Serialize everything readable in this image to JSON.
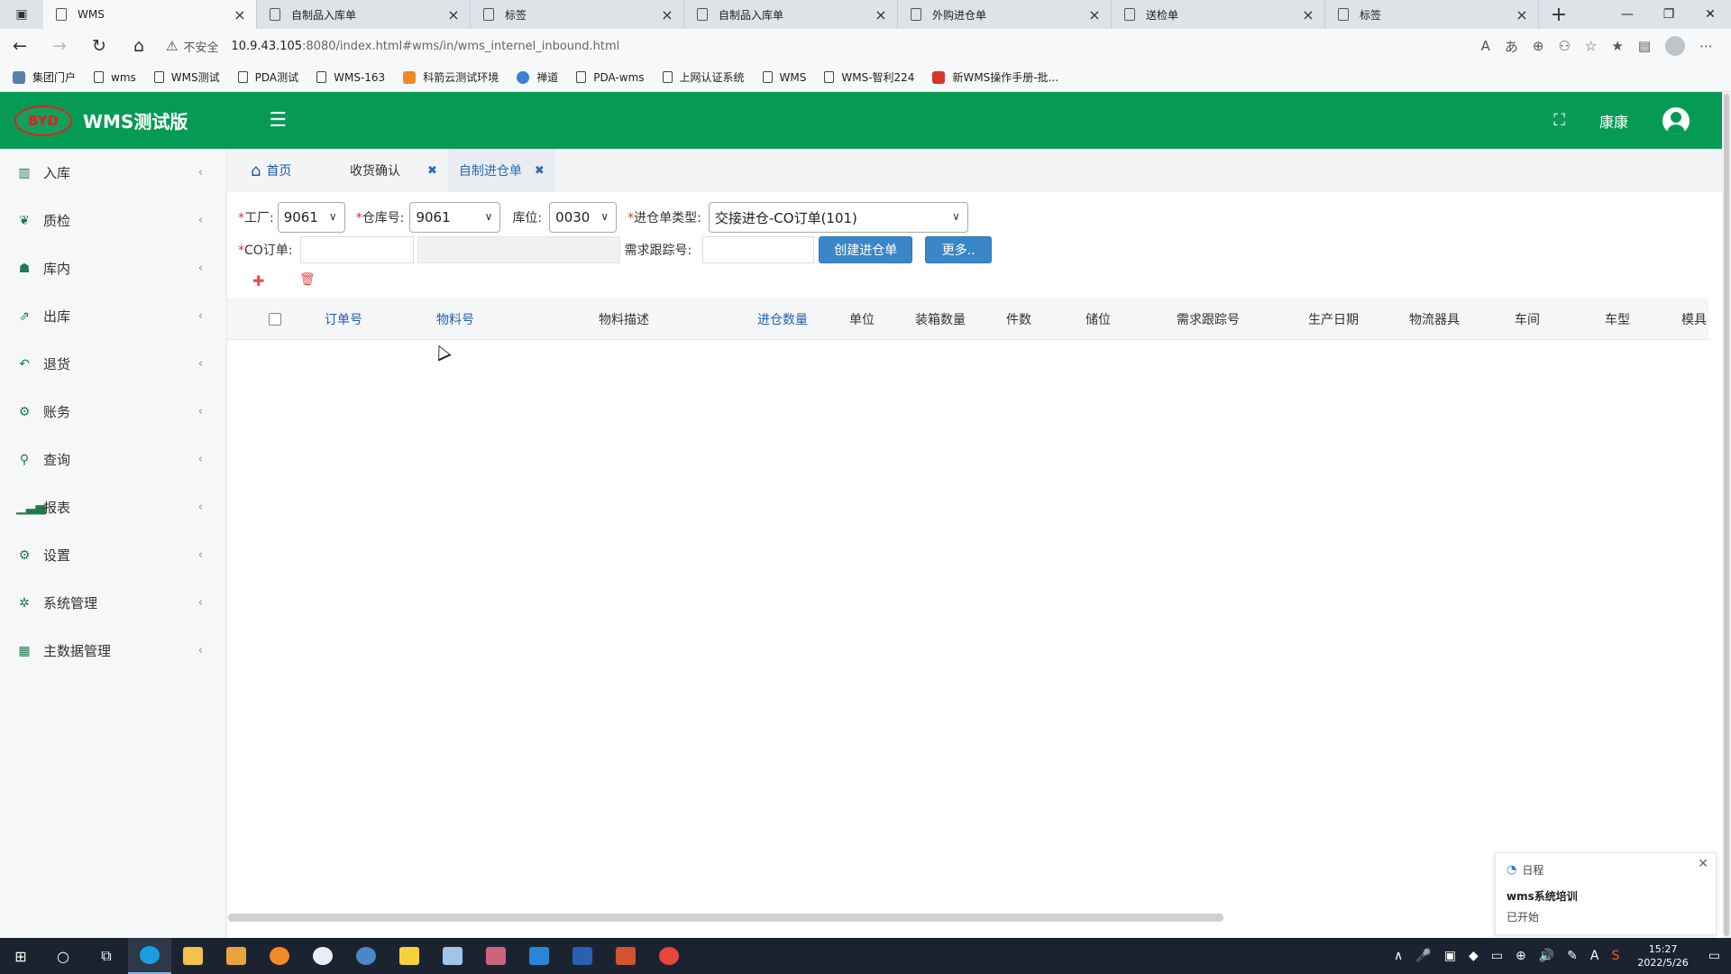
{
  "browser": {
    "tabs": [
      {
        "title": "WMS",
        "active": true
      },
      {
        "title": "自制品入库单",
        "active": false
      },
      {
        "title": "标签",
        "active": false
      },
      {
        "title": "自制品入库单",
        "active": false
      },
      {
        "title": "外购进仓单",
        "active": false
      },
      {
        "title": "送检单",
        "active": false
      },
      {
        "title": "标签",
        "active": false
      }
    ],
    "insecure_label": "不安全",
    "url_host": "10.9.43.105",
    "url_rest": ":8080/index.html#wms/in/wms_internel_inbound.html",
    "bookmarks": [
      "集团门户",
      "wms",
      "WMS测试",
      "PDA测试",
      "WMS-163",
      "科箭云测试环境",
      "禅道",
      "PDA-wms",
      "上网认证系统",
      "WMS",
      "WMS-智利224",
      "新WMS操作手册-批..."
    ]
  },
  "header": {
    "logo_text": "BYD",
    "title": "WMS测试版",
    "username": "康康",
    "brand_color": "#069b55"
  },
  "sidebar": {
    "items": [
      {
        "label": "入库",
        "icon": "barcode-icon"
      },
      {
        "label": "质检",
        "icon": "leaf-icon"
      },
      {
        "label": "库内",
        "icon": "cubes-icon"
      },
      {
        "label": "出库",
        "icon": "share-icon"
      },
      {
        "label": "退货",
        "icon": "reply-icon"
      },
      {
        "label": "账务",
        "icon": "gears-icon"
      },
      {
        "label": "查询",
        "icon": "search-icon"
      },
      {
        "label": "报表",
        "icon": "signal-icon"
      },
      {
        "label": "设置",
        "icon": "cogs-icon"
      },
      {
        "label": "系统管理",
        "icon": "gear-icon"
      },
      {
        "label": "主数据管理",
        "icon": "table-icon"
      }
    ]
  },
  "page_tabs": [
    {
      "label": "首页",
      "closable": false
    },
    {
      "label": "收货确认",
      "closable": true
    },
    {
      "label": "自制进仓单",
      "closable": true,
      "active": true
    }
  ],
  "form": {
    "factory_label": "工厂:",
    "factory_value": "9061",
    "warehouse_label": "仓库号:",
    "warehouse_value": "9061",
    "location_label": "库位:",
    "location_value": "0030",
    "inbound_type_label": "进仓单类型:",
    "inbound_type_value": "交接进仓-CO订单(101)",
    "co_order_label": "CO订单:",
    "co_order_value": "",
    "co_order_desc": "",
    "demand_track_label": "需求跟踪号:",
    "demand_track_value": "",
    "create_button": "创建进仓单",
    "more_button": "更多.."
  },
  "table": {
    "columns": [
      "订单号",
      "物料号",
      "物料描述",
      "进仓数量",
      "单位",
      "装箱数量",
      "件数",
      "储位",
      "需求跟踪号",
      "生产日期",
      "物流器具",
      "车间",
      "车型",
      "模具"
    ],
    "rows": []
  },
  "notification": {
    "header": "日程",
    "title": "wms系统培训",
    "status": "已开始"
  },
  "taskbar": {
    "time": "15:27",
    "date": "2022/5/26"
  }
}
